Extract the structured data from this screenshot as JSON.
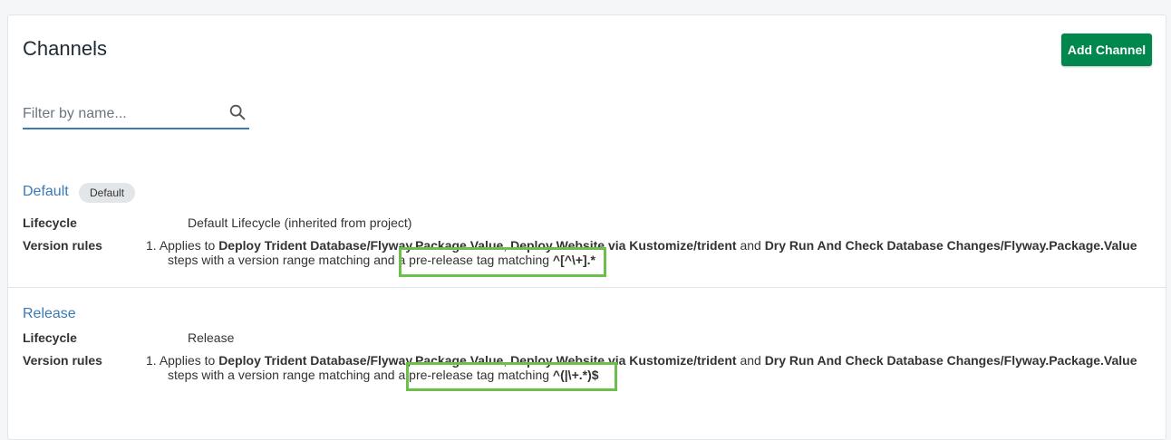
{
  "header": {
    "title": "Channels",
    "add_button": "Add Channel"
  },
  "filter": {
    "placeholder": "Filter by name...",
    "value": ""
  },
  "labels": {
    "lifecycle": "Lifecycle",
    "version_rules": "Version rules"
  },
  "channels": [
    {
      "name": "Default",
      "badge": "Default",
      "lifecycle": "Default Lifecycle (inherited from project)",
      "rule": {
        "number": "1.",
        "applies_to": "Applies to",
        "steps_a": "Deploy Trident Database/Flyway.Package.Value",
        "sep": ",",
        "steps_b": "Deploy Website via Kustomize/trident",
        "and": "and",
        "steps_c": "Dry Run And Check Database Changes/Flyway.Package.Value",
        "line2_prefix": "steps with a version range matching and a",
        "tag_text": "pre-release tag matching",
        "tag_value": "^[^\\+].*"
      }
    },
    {
      "name": "Release",
      "badge": "",
      "lifecycle": "Release",
      "rule": {
        "number": "1.",
        "applies_to": "Applies to",
        "steps_a": "Deploy Trident Database/Flyway.Package.Value",
        "sep": ",",
        "steps_b": "Deploy Website via Kustomize/trident",
        "and": "and",
        "steps_c": "Dry Run And Check Database Changes/Flyway.Package.Value",
        "line2_prefix": "steps with a version range matching and a",
        "tag_text": "pre-release tag matching",
        "tag_value": "^(|\\+.*)$"
      }
    }
  ]
}
